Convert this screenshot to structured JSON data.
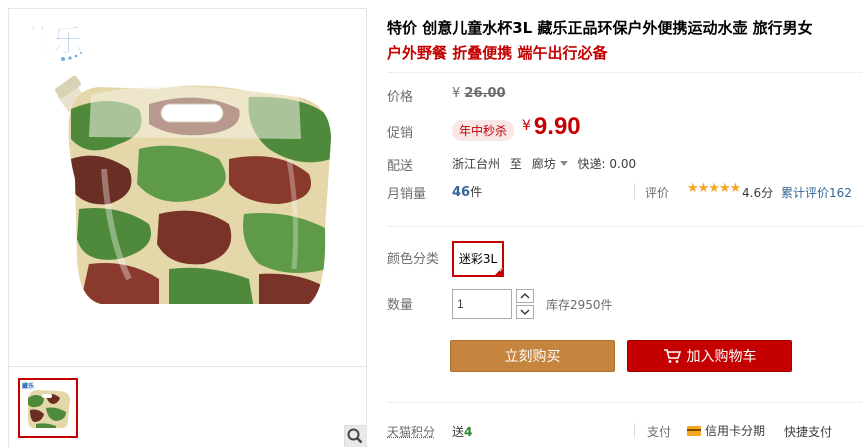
{
  "brand": {
    "logo_text": "藏乐"
  },
  "product": {
    "title": "特价 创意儿童水杯3L 藏乐正品环保户外便携运动水壶 旅行男女",
    "subtitle": "户外野餐 折叠便携 端午出行必备"
  },
  "price": {
    "label": "价格",
    "currency": "¥",
    "original": "26.00"
  },
  "promo": {
    "label": "促销",
    "badge": "年中秒杀",
    "currency": "¥",
    "price": "9.90"
  },
  "shipping": {
    "label": "配送",
    "from": "浙江台州",
    "to_word": "至",
    "destination": "廊坊",
    "fee_label": "快递: 0.00"
  },
  "sales": {
    "label": "月销量",
    "count": "46",
    "unit": "件",
    "rating_label": "评价",
    "stars": "★★★★★",
    "score": "4.6分",
    "review_total": "累计评价162"
  },
  "sku": {
    "label": "颜色分类",
    "selected": "迷彩3L"
  },
  "quantity": {
    "label": "数量",
    "value": "1",
    "stock": "库存2950件"
  },
  "actions": {
    "buy_now": "立刻购买",
    "add_to_cart": "加入购物车"
  },
  "footer": {
    "points_label": "天猫积分",
    "points_prefix": "送",
    "points_value": "4",
    "pay_label": "支付",
    "pay_card": "信用卡分期",
    "pay_quick": "快捷支付"
  },
  "colors": {
    "accent_red": "#c40000",
    "buy_orange": "#c6853e",
    "link_blue": "#336699",
    "star": "#f5a623"
  },
  "icons": [
    "zoom-icon",
    "cart-icon",
    "credit-card-icon",
    "chevron-up-icon",
    "chevron-down-icon",
    "caret-down-icon",
    "check-icon"
  ]
}
